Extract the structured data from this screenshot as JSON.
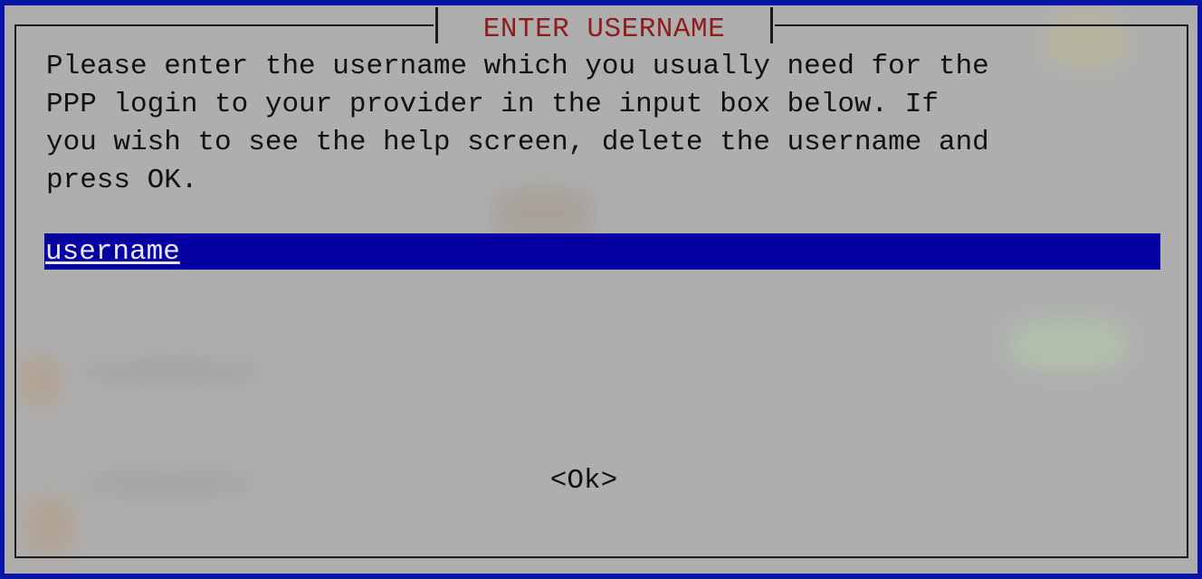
{
  "dialog": {
    "title": "ENTER USERNAME",
    "message": "Please enter the username which you usually need for the\nPPP login to your provider in the input box below. If\nyou wish to see the help screen, delete the username and\npress OK.",
    "input": {
      "value": "username"
    },
    "ok_label": "<Ok>"
  },
  "colors": {
    "screen_background": "#0b14a8",
    "dialog_background": "#aeaeae",
    "title_text": "#8f1d1d",
    "input_background": "#0600a3",
    "input_text": "#e8e8ff"
  }
}
